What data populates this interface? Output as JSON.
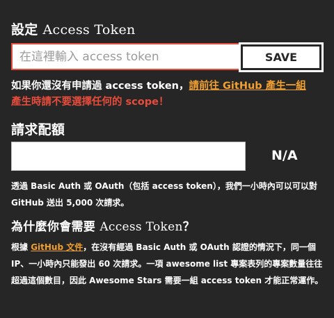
{
  "token_section": {
    "title_cjk": "設定 ",
    "title_latin": "Access Token",
    "input_placeholder": "在這裡輸入 access token",
    "input_value": "",
    "save_label": "SAVE",
    "hint_prefix": "如果你還沒有申請過 access token，",
    "hint_link": "請前往 GitHub 產生一組",
    "hint_warning": "產生時請不要選擇任何的 scope！"
  },
  "quota_section": {
    "title": "請求配額",
    "value": "N/A",
    "description": "透過 Basic Auth 或 OAuth（包括 access token），我們一小時內可以可以對 GitHub 送出 5,000 次請求。"
  },
  "why_section": {
    "title_cjk_1": "為什麼你會需要 ",
    "title_latin": "Access Token",
    "title_cjk_2": "？",
    "para_prefix": "根據 ",
    "para_link": "GitHub 文件",
    "para_rest": "，在沒有經過 Basic Auth 或 OAuth 認證的情況下，同一個 IP、一小時內只能發出 60 次請求。一項 awesome list 專案表列的專案數量往往超過這個數目，因此 Awesome Stars 需要一組 access token 才能正常運作。"
  },
  "colors": {
    "background": "#262626",
    "error_border": "#e74c3c",
    "link": "#f0a030"
  }
}
